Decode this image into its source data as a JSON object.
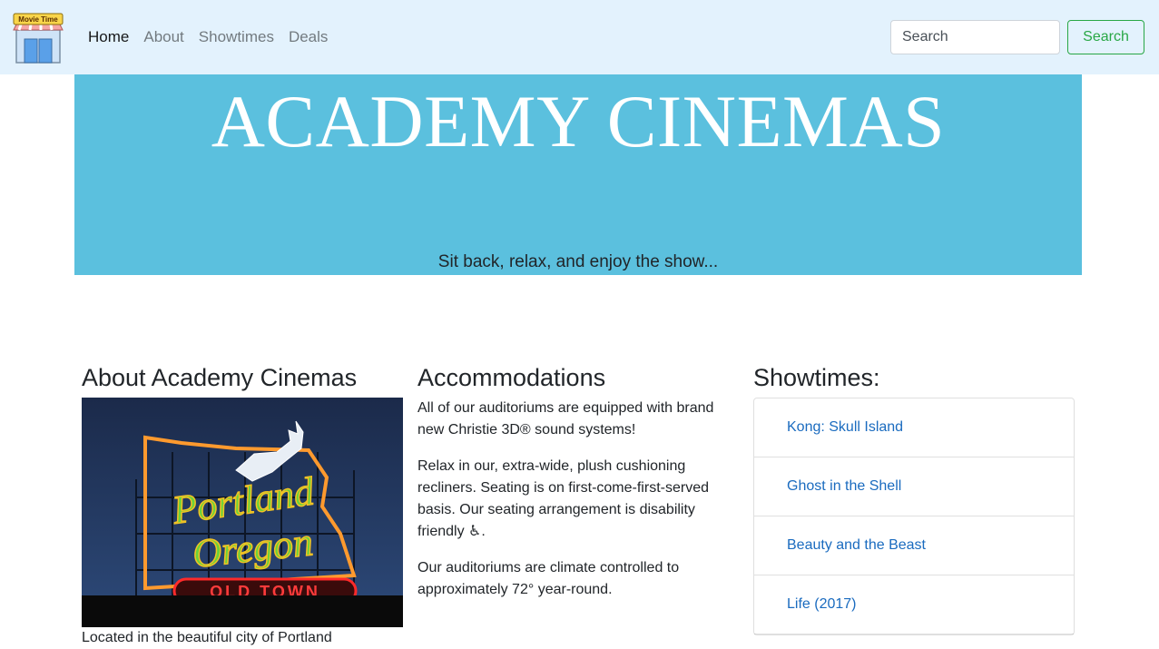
{
  "navbar": {
    "logo_text": "Movie Time",
    "links": [
      {
        "label": "Home",
        "active": true
      },
      {
        "label": "About",
        "active": false
      },
      {
        "label": "Showtimes",
        "active": false
      },
      {
        "label": "Deals",
        "active": false
      }
    ],
    "search": {
      "placeholder": "Search",
      "button_label": "Search"
    }
  },
  "jumbotron": {
    "title": "ACADEMY CINEMAS",
    "lead": "Sit back, relax, and enjoy the show..."
  },
  "about": {
    "heading": "About Academy Cinemas",
    "caption": "Located in the beautiful city of Portland",
    "photo_text": [
      "Portland",
      "Oregon",
      "OLD TOWN"
    ]
  },
  "accommodations": {
    "heading": "Accommodations",
    "paragraphs": [
      "All of our auditoriums are equipped with brand new Christie 3D® sound systems!",
      "Relax in our, extra-wide, plush cushioning recliners. Seating is on first-come-first-served basis. Our seating arrangement is disability friendly ♿.",
      "Our auditoriums are climate controlled to approximately 72° year-round."
    ]
  },
  "showtimes": {
    "heading": "Showtimes:",
    "movies": [
      "Kong: Skull Island",
      "Ghost in the Shell",
      "Beauty and the Beast",
      "Life (2017)"
    ]
  },
  "colors": {
    "navbar_bg": "#e3f2fd",
    "jumbotron_bg": "#5bc0de",
    "success": "#28a745",
    "link": "#1a6bbf"
  }
}
